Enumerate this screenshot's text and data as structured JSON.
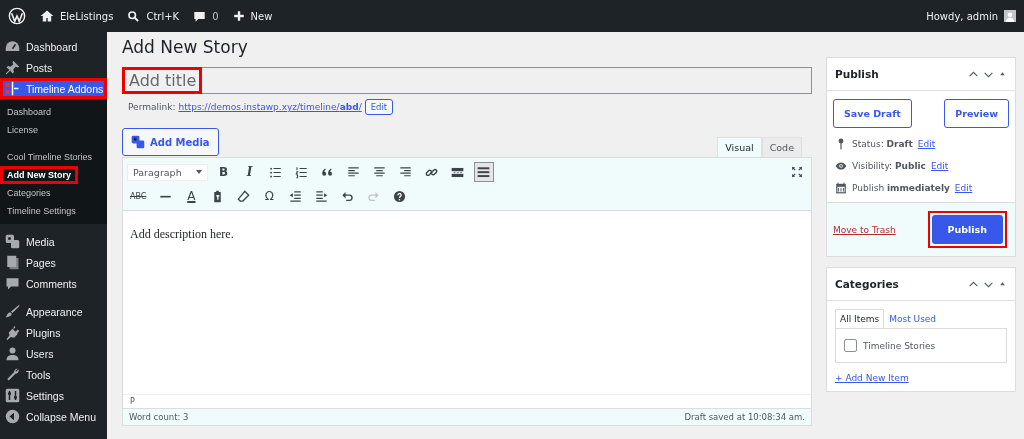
{
  "admin_bar": {
    "site": "EleListings",
    "search": "Ctrl+K",
    "comments": "0",
    "new": "New",
    "greeting": "Howdy, admin"
  },
  "menu": [
    {
      "label": "Dashboard",
      "selected": false,
      "highlighted": false
    },
    {
      "label": "Posts",
      "selected": false,
      "highlighted": false
    },
    {
      "label": "Timeline Addons",
      "selected": true,
      "highlighted": true,
      "children": [
        {
          "label": "Dashboard",
          "selected": false,
          "highlighted": false
        },
        {
          "label": "License",
          "selected": false,
          "highlighted": false
        },
        {
          "label": "Cool Timeline Stories",
          "selected": false,
          "highlighted": false
        },
        {
          "label": "Add New Story",
          "selected": true,
          "highlighted": true
        },
        {
          "label": "Categories",
          "selected": false,
          "highlighted": false
        },
        {
          "label": "Timeline Settings",
          "selected": false,
          "highlighted": false
        }
      ]
    },
    {
      "label": "Media",
      "selected": false,
      "highlighted": false
    },
    {
      "label": "Pages",
      "selected": false,
      "highlighted": false
    },
    {
      "label": "Comments",
      "selected": false,
      "highlighted": false
    },
    {
      "label": "Appearance",
      "selected": false,
      "highlighted": false
    },
    {
      "label": "Plugins",
      "selected": false,
      "highlighted": false
    },
    {
      "label": "Users",
      "selected": false,
      "highlighted": false
    },
    {
      "label": "Tools",
      "selected": false,
      "highlighted": false
    },
    {
      "label": "Settings",
      "selected": false,
      "highlighted": false
    },
    {
      "label": "Collapse Menu",
      "selected": false,
      "highlighted": false
    }
  ],
  "page_title": "Add New Story",
  "title_field": {
    "placeholder": "Add title",
    "highlighted": true
  },
  "permalink": {
    "label": "Permalink:",
    "url": "https://demos.instawp.xyz/timeline/**abd**/",
    "edit": "Edit"
  },
  "add_media": "Add Media",
  "editor_tabs": [
    {
      "label": "Visual",
      "selected": true
    },
    {
      "label": "Code",
      "selected": false
    }
  ],
  "format_select": "Paragraph",
  "toolbar_rows": [
    [
      {
        "kind": "bold",
        "label": "B",
        "pressed": false,
        "disabled": false
      },
      {
        "kind": "italic",
        "label": "I",
        "pressed": false,
        "disabled": false
      },
      {
        "kind": "bullets",
        "pressed": false,
        "disabled": false
      },
      {
        "kind": "numbers",
        "pressed": false,
        "disabled": false
      },
      {
        "kind": "quote",
        "pressed": false,
        "disabled": false
      },
      {
        "kind": "align-left",
        "pressed": false,
        "disabled": false
      },
      {
        "kind": "align-center",
        "pressed": false,
        "disabled": false
      },
      {
        "kind": "align-right",
        "pressed": false,
        "disabled": false
      },
      {
        "kind": "link",
        "pressed": false,
        "disabled": false
      },
      {
        "kind": "more",
        "pressed": false,
        "disabled": false
      },
      {
        "kind": "toggle",
        "pressed": true,
        "disabled": false
      }
    ],
    [
      {
        "kind": "strike",
        "label": "ABC",
        "pressed": false,
        "disabled": false
      },
      {
        "kind": "hr",
        "pressed": false,
        "disabled": false
      },
      {
        "kind": "color",
        "label": "A",
        "pressed": false,
        "disabled": false
      },
      {
        "kind": "paste",
        "pressed": false,
        "disabled": false
      },
      {
        "kind": "eraser",
        "pressed": false,
        "disabled": false
      },
      {
        "kind": "omega",
        "label": "Ω",
        "pressed": false,
        "disabled": false
      },
      {
        "kind": "outdent",
        "pressed": false,
        "disabled": false
      },
      {
        "kind": "indent",
        "pressed": false,
        "disabled": false
      },
      {
        "kind": "undo",
        "pressed": false,
        "disabled": false
      },
      {
        "kind": "redo",
        "pressed": false,
        "disabled": true
      },
      {
        "kind": "help",
        "pressed": false,
        "disabled": false
      }
    ]
  ],
  "content": "Add description here.",
  "path": "P",
  "word_count": "Word count: 3",
  "saved": "Draft saved at 10:08:34 am.",
  "publish_box": {
    "title": "Publish",
    "save_draft": "Save Draft",
    "preview": "Preview",
    "rows": [
      {
        "kind": "status",
        "text": "Status: **Draft**",
        "link": "Edit"
      },
      {
        "kind": "visibility",
        "text": "Visibility: **Public**",
        "link": "Edit"
      },
      {
        "kind": "schedule",
        "text": "Publish **immediately**",
        "link": "Edit"
      }
    ],
    "trash": "Move to Trash",
    "publish": "Publish",
    "publish_highlighted": true
  },
  "categories_box": {
    "title": "Categories",
    "tabs": [
      {
        "label": "All Items",
        "selected": true
      },
      {
        "label": "Most Used",
        "selected": false
      }
    ],
    "items": [
      {
        "label": "Timeline Stories",
        "checked": false
      }
    ],
    "add_new": "+ Add New Item"
  }
}
